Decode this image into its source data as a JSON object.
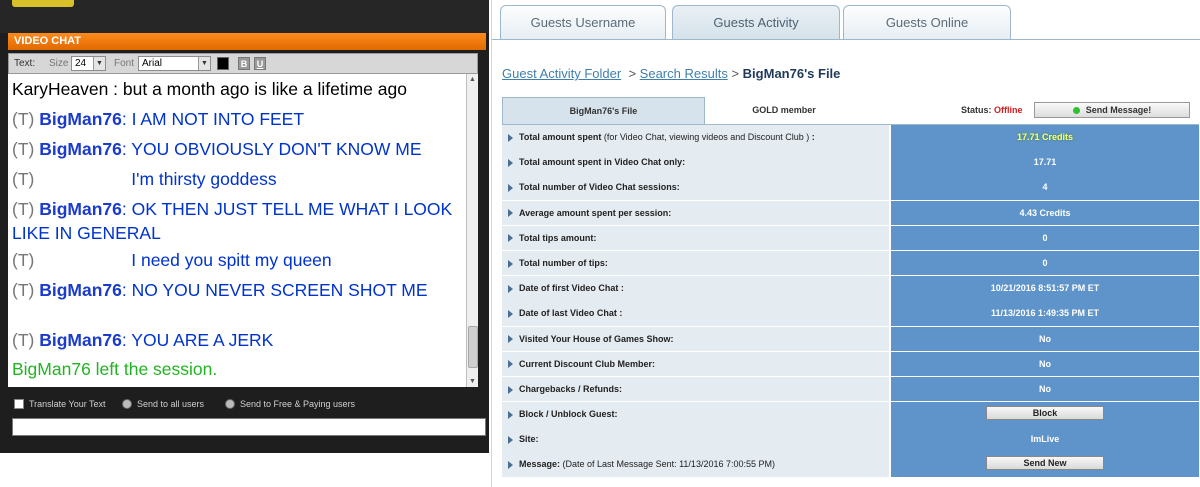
{
  "chat": {
    "title": "VIDEO CHAT",
    "toolbar": {
      "text_label": "Text:",
      "size_label": "Size",
      "size_value": "24",
      "font_label": "Font",
      "font_value": "Arial",
      "bold_label": "B",
      "underline_label": "U"
    },
    "messages": [
      {
        "tag": "",
        "nick": "",
        "text": "KaryHeaven : but a month ago is like a lifetime ago"
      },
      {
        "tag": "(T)",
        "nick": "BigMan76",
        "text": ": I AM NOT INTO FEET"
      },
      {
        "tag": "(T)",
        "nick": "BigMan76",
        "text": ": YOU OBVIOUSLY DON'T KNOW ME"
      },
      {
        "tag": "(T)",
        "nick": "",
        "text": "I'm thirsty goddess"
      },
      {
        "tag": "(T)",
        "nick": "BigMan76",
        "text": ": OK THEN JUST TELL ME WHAT I LOOK LIKE IN GENERAL"
      },
      {
        "tag": "(T)",
        "nick": "",
        "text": "I need you spitt my queen"
      },
      {
        "tag": "(T)",
        "nick": "BigMan76",
        "text": ": NO YOU NEVER SCREEN SHOT ME"
      },
      {
        "tag": "(T)",
        "nick": "BigMan76",
        "text": ": YOU ARE A JERK"
      },
      {
        "tag": "",
        "nick": "",
        "text": "BigMan76 left the session."
      }
    ],
    "options": {
      "translate_label": "Translate Your Text",
      "send_all_label": "Send to all users",
      "send_paying_label": "Send to Free & Paying users"
    }
  },
  "guest": {
    "tabs": [
      "Guests Username",
      "Guests Activity",
      "Guests Online"
    ],
    "active_tab": "Guests Activity",
    "breadcrumb": {
      "folder": "Guest Activity Folder",
      "sep": ">",
      "search": "Search Results",
      "current": "BigMan76's File"
    },
    "subtabs": {
      "file": "BigMan76's File",
      "member": "GOLD member",
      "status_label": "Status:",
      "status_value": "Offline",
      "send_message": "Send Message!"
    },
    "rows": [
      {
        "label": "Total amount spent",
        "extra": " (for Video Chat, viewing videos and Discount Club )",
        "suffix": " :",
        "value": "17.71 Credits"
      },
      {
        "label": "Total amount spent in Video Chat only:",
        "extra": "",
        "suffix": "",
        "value": "17.71"
      },
      {
        "label": "Total number of Video Chat sessions:",
        "extra": "",
        "suffix": "",
        "value": "4"
      },
      {
        "label": "Average amount spent per session:",
        "extra": "",
        "suffix": "",
        "value": "4.43 Credits"
      },
      {
        "label": "Total tips amount:",
        "extra": "",
        "suffix": "",
        "value": "0"
      },
      {
        "label": "Total number of tips:",
        "extra": "",
        "suffix": "",
        "value": "0"
      },
      {
        "label": "Date of first Video Chat :",
        "extra": "",
        "suffix": "",
        "value": "10/21/2016 8:51:57 PM ET"
      },
      {
        "label": "Date of last Video Chat :",
        "extra": "",
        "suffix": "",
        "value": "11/13/2016 1:49:35 PM ET"
      },
      {
        "label": "Visited Your House of Games Show:",
        "extra": "",
        "suffix": "",
        "value": "No"
      },
      {
        "label": "Current Discount Club Member:",
        "extra": "",
        "suffix": "",
        "value": "No"
      },
      {
        "label": "Chargebacks / Refunds:",
        "extra": "",
        "suffix": "",
        "value": "No"
      },
      {
        "label": "Block / Unblock Guest:",
        "extra": "",
        "suffix": "",
        "button": "Block"
      },
      {
        "label": "Site:",
        "extra": "",
        "suffix": "",
        "value": "ImLive"
      },
      {
        "label": "Message:",
        "extra": " (Date of Last Message Sent: 11/13/2016 7:00:55 PM)",
        "suffix": "",
        "button": "Send New"
      }
    ]
  },
  "colors": {
    "chat_title_bar": "#f07a10",
    "chat_nick": "#1a3bcc",
    "chat_left_message": "#22b422",
    "offline": "#d21d1d",
    "value_cell": "#5e94c9",
    "label_cell": "#e4ebf1"
  }
}
